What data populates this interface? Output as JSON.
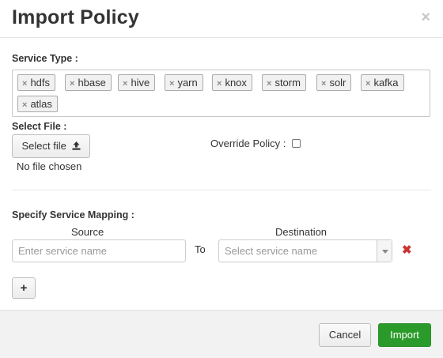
{
  "dialog": {
    "title": "Import Policy",
    "close_glyph": "×"
  },
  "service_type": {
    "label": "Service Type :",
    "tags": [
      "hdfs",
      "hbase",
      "hive",
      "yarn",
      "knox",
      "storm",
      "solr",
      "kafka",
      "atlas"
    ],
    "remove_glyph": "×"
  },
  "select_file": {
    "label": "Select File :",
    "button_label": "Select file",
    "icon": "upload-icon",
    "status": "No file chosen"
  },
  "override": {
    "label": "Override Policy :",
    "checked": false
  },
  "mapping": {
    "label": "Specify Service Mapping :",
    "source_header": "Source",
    "destination_header": "Destination",
    "to_text": "To",
    "source_placeholder": "Enter service name",
    "destination_placeholder": "Select service name",
    "remove_glyph": "✖",
    "add_glyph": "+"
  },
  "footer": {
    "cancel_label": "Cancel",
    "import_label": "Import"
  },
  "colors": {
    "primary": "#2a9b2a",
    "remove": "#cc3333"
  }
}
